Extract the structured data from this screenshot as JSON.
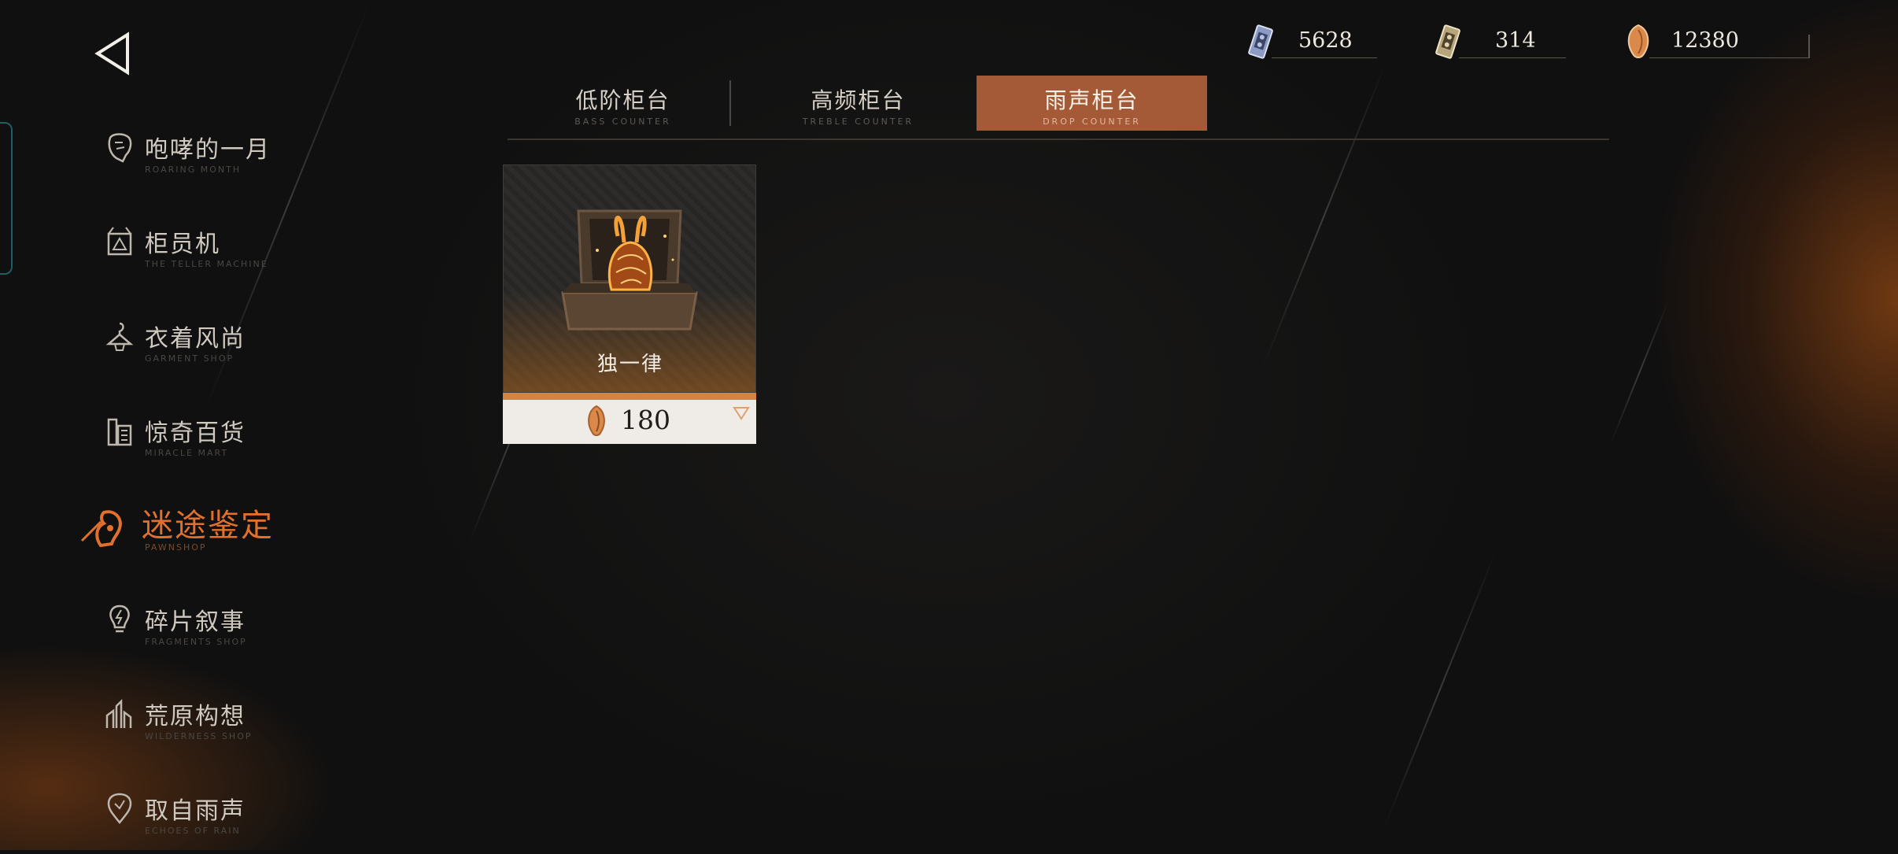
{
  "currencies": [
    {
      "icon": "blue-cassette-icon",
      "value": "5628"
    },
    {
      "icon": "gold-cassette-icon",
      "value": "314"
    },
    {
      "icon": "amber-shell-icon",
      "value": "12380"
    }
  ],
  "sidebar": {
    "items": [
      {
        "cn": "咆哮的一月",
        "en": "ROARING MONTH",
        "icon": "lion-head-icon"
      },
      {
        "cn": "柜员机",
        "en": "THE TELLER MACHINE",
        "icon": "teller-machine-icon"
      },
      {
        "cn": "衣着风尚",
        "en": "GARMENT SHOP",
        "icon": "hanger-icon"
      },
      {
        "cn": "惊奇百货",
        "en": "MIRACLE MART",
        "icon": "building-icon"
      },
      {
        "cn": "迷途鉴定",
        "en": "PAWNSHOP",
        "icon": "pawnshop-icon"
      },
      {
        "cn": "碎片叙事",
        "en": "FRAGMENTS SHOP",
        "icon": "bulb-icon"
      },
      {
        "cn": "荒原构想",
        "en": "WILDERNESS SHOP",
        "icon": "factory-icon"
      },
      {
        "cn": "取自雨声",
        "en": "ECHOES OF RAIN",
        "icon": "map-pin-icon"
      }
    ],
    "active_index": 4
  },
  "tabs": [
    {
      "cn": "低阶柜台",
      "en": "BASS COUNTER"
    },
    {
      "cn": "高频柜台",
      "en": "TREBLE COUNTER"
    },
    {
      "cn": "雨声柜台",
      "en": "DROP COUNTER"
    }
  ],
  "active_tab": 2,
  "items": [
    {
      "name": "独一律",
      "price": "180",
      "price_icon": "amber-shell-icon"
    }
  ],
  "colors": {
    "accent": "#e0702e",
    "active_tab_bg": "#a45a36",
    "price_stripe": "#d4843f",
    "background": "#111010"
  }
}
